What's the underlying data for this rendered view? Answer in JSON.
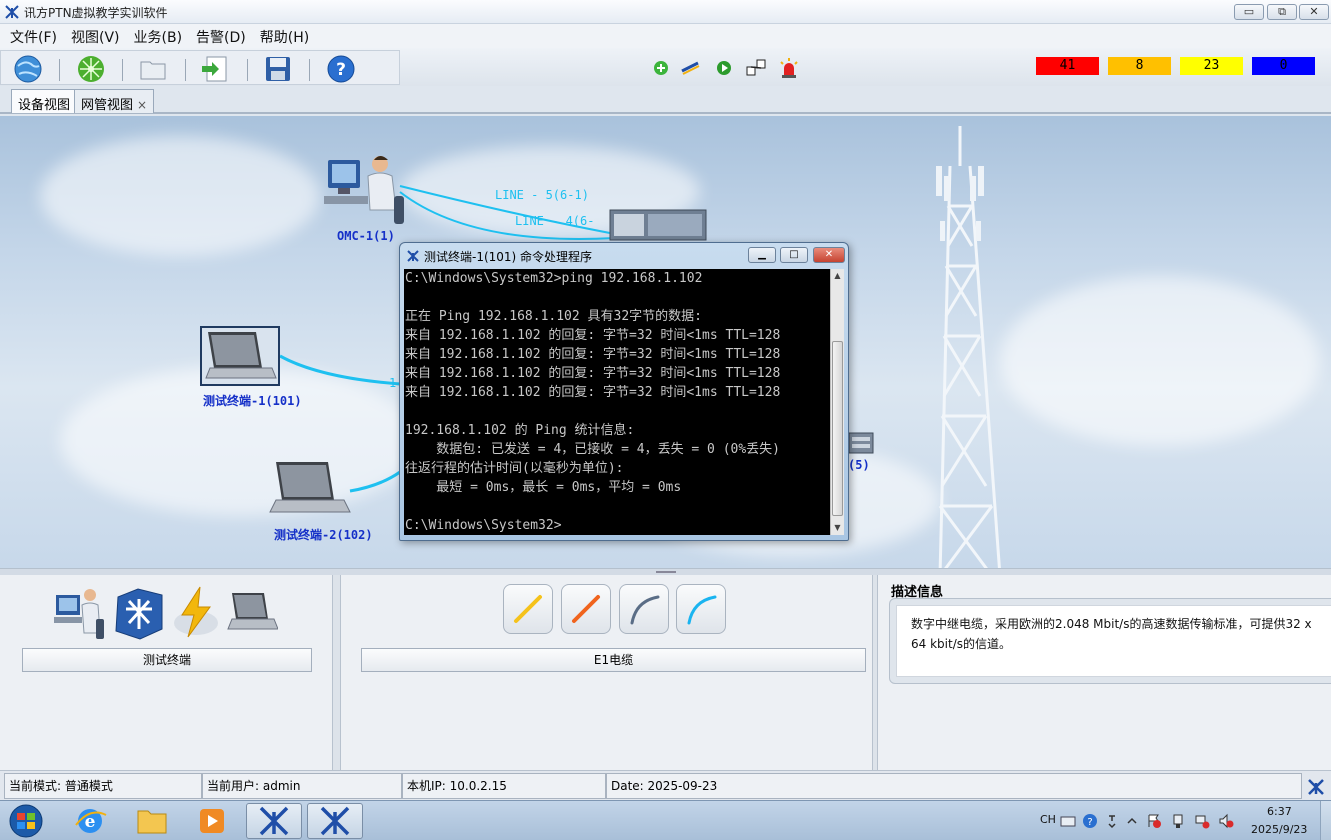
{
  "app": {
    "title": "讯方PTN虚拟教学实训软件"
  },
  "window_controls": {
    "minimize": "▭",
    "maximize": "⧉",
    "close": "✕"
  },
  "menu": {
    "items": [
      "文件(F)",
      "视图(V)",
      "业务(B)",
      "告警(D)",
      "帮助(H)"
    ]
  },
  "toolbar": {
    "icons": [
      "globe-icon",
      "network-icon",
      "folder-icon",
      "export-icon",
      "save-icon",
      "help-icon"
    ],
    "alarms": [
      {
        "value": "41",
        "color": "#ff0000"
      },
      {
        "value": "8",
        "color": "#ffc000"
      },
      {
        "value": "23",
        "color": "#ffff00"
      },
      {
        "value": "0",
        "color": "#0000ff"
      }
    ]
  },
  "tabs": [
    {
      "label": "设备视图",
      "active": true
    },
    {
      "label": "网管视图",
      "close": "×",
      "active": false
    }
  ],
  "topology": {
    "nodes": {
      "omc": "OMC-1(1)",
      "terminal1": "测试终端-1(101)",
      "terminal2": "测试终端-2(102)",
      "partial": "(5)"
    },
    "links": {
      "line5": "LINE - 5(6-1)",
      "line4": "LINE - 4(6-",
      "line_partial": "1"
    }
  },
  "cmd_window": {
    "title": "测试终端-1(101) 命令处理程序",
    "lines": [
      "C:\\Windows\\System32>ping 192.168.1.102",
      "",
      "正在 Ping 192.168.1.102 具有32字节的数据:",
      "来自 192.168.1.102 的回复: 字节=32 时间<1ms TTL=128",
      "来自 192.168.1.102 的回复: 字节=32 时间<1ms TTL=128",
      "来自 192.168.1.102 的回复: 字节=32 时间<1ms TTL=128",
      "来自 192.168.1.102 的回复: 字节=32 时间<1ms TTL=128",
      "",
      "192.168.1.102 的 Ping 统计信息:",
      "    数据包: 已发送 = 4，已接收 = 4，丢失 = 0 (0%丢失)",
      "往返行程的估计时间(以毫秒为单位):",
      "    最短 = 0ms，最长 = 0ms，平均 = 0ms",
      "",
      "C:\\Windows\\System32>"
    ]
  },
  "device_panel": {
    "caption": "测试终端"
  },
  "cable_panel": {
    "caption": "E1电缆",
    "cable_colors": [
      "#f5c21b",
      "#f0641e",
      "#5a6d86",
      "#1ab4f0"
    ]
  },
  "description": {
    "title": "描述信息",
    "text": "数字中继电缆，采用欧洲的2.048 Mbit/s的高速数据传输标准，可提供32 x 64 kbit/s的信道。"
  },
  "status": {
    "mode": "当前模式: 普通模式",
    "user": "当前用户: admin",
    "ip": "本机IP: 10.0.2.15",
    "date": "Date: 2025-09-23"
  },
  "taskbar": {
    "time": "6:37",
    "date": "2025/9/23",
    "lang": "CH"
  }
}
